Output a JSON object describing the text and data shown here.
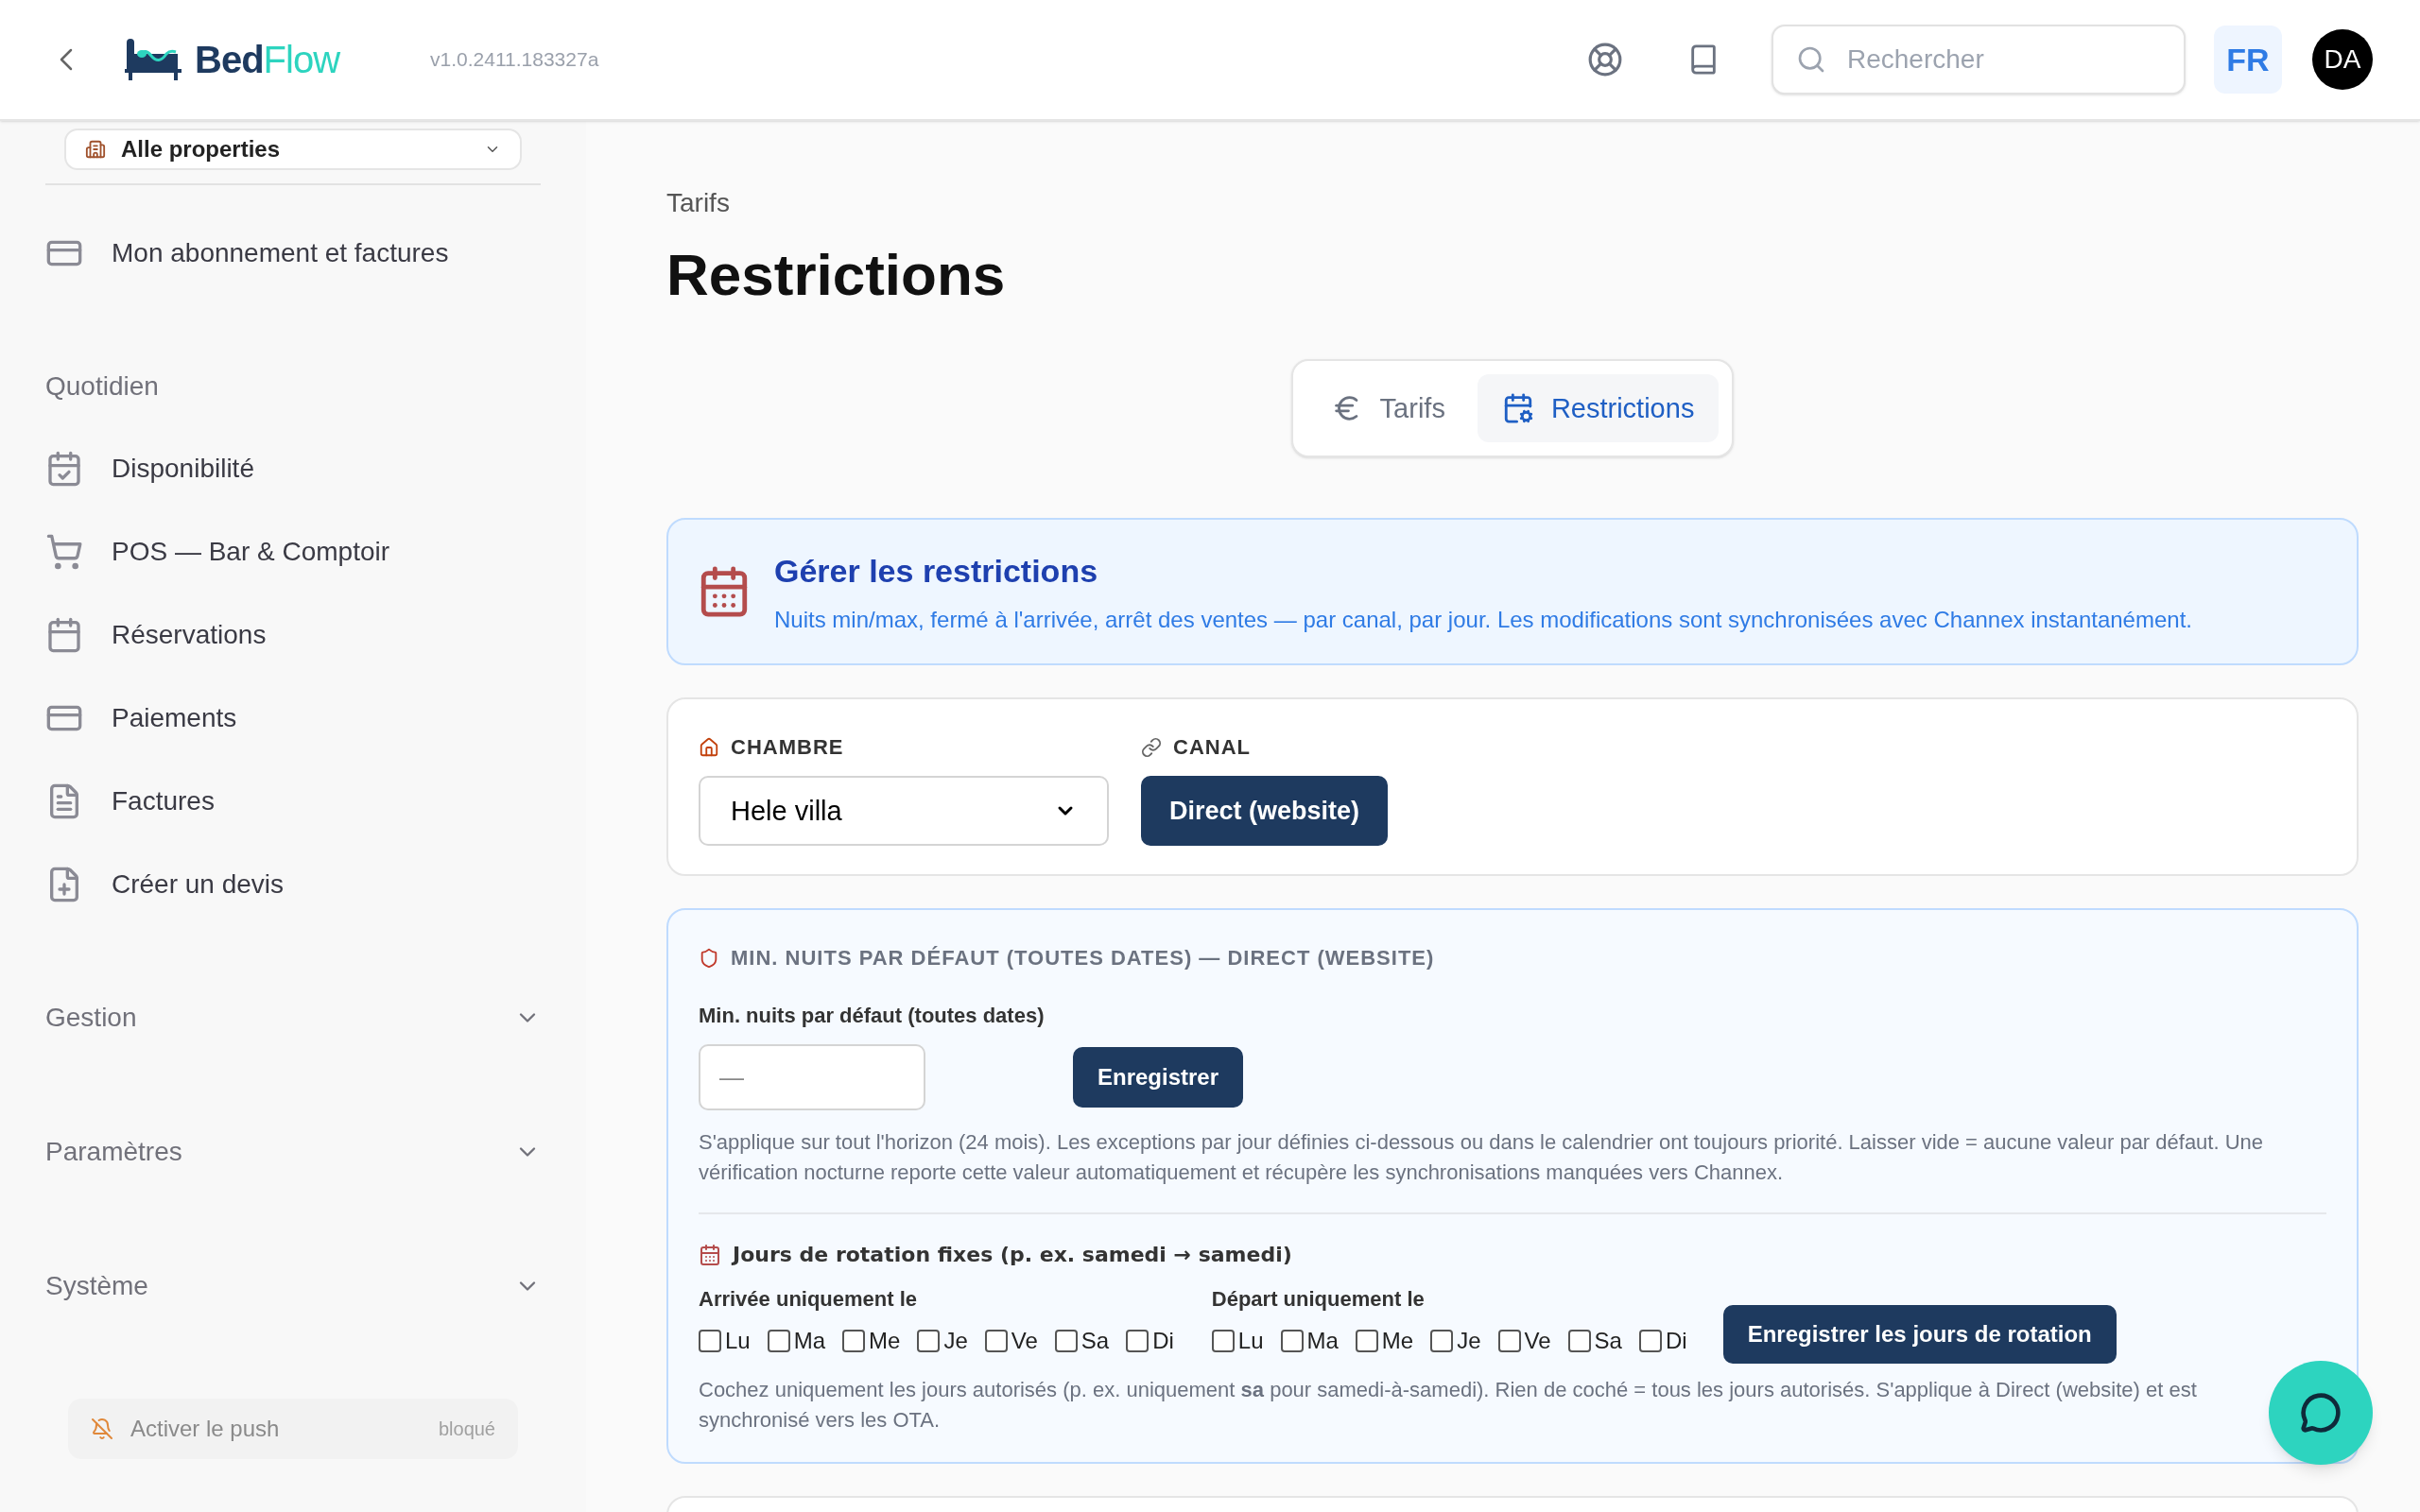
{
  "header": {
    "logo": [
      "Bed",
      "Flow"
    ],
    "version": "v1.0.2411.183327a",
    "search": {
      "placeholder": "Rechercher"
    },
    "language": "FR",
    "avatar": "DA"
  },
  "sidebar": {
    "property_select": "Alle properties",
    "top_items": [
      {
        "label": "Mon abonnement et factures",
        "kind": "card"
      }
    ],
    "section": "Quotidien",
    "items": [
      {
        "label": "Disponibilité",
        "kind": "calendar-check"
      },
      {
        "label": "POS — Bar & Comptoir",
        "kind": "cart"
      },
      {
        "label": "Réservations",
        "kind": "calendar"
      },
      {
        "label": "Paiements",
        "kind": "card"
      },
      {
        "label": "Factures",
        "kind": "file"
      },
      {
        "label": "Créer un devis",
        "kind": "file-plus"
      }
    ],
    "groups": [
      {
        "label": "Gestion",
        "expanded": false
      },
      {
        "label": "Paramètres",
        "expanded": false
      },
      {
        "label": "Système",
        "expanded": false
      }
    ],
    "push": {
      "label": "Activer le push",
      "status": "bloqué"
    }
  },
  "breadcrumb": "Tarifs",
  "title": "Restrictions",
  "tabs": [
    {
      "label": "Tarifs",
      "kind": "euro",
      "selected": false
    },
    {
      "label": "Restrictions",
      "kind": "calendar-cog",
      "selected": true
    }
  ],
  "banner": {
    "title": "Gérer les restrictions",
    "text": "Nuits min/max, fermé à l'arrivée, arrêt des ventes — par canal, par jour. Les modifications sont synchronisées avec Channex instantanément."
  },
  "filters": {
    "room_label": "CHAMBRE",
    "room_value": "Hele villa",
    "channel_label": "CANAL",
    "channels": [
      {
        "label": "Direct (website)",
        "selected": true
      }
    ]
  },
  "min_nights": {
    "heading": "MIN. NUITS PAR DÉFAUT (TOUTES DATES) — DIRECT (WEBSITE)",
    "field_label": "Min. nuits par défaut (toutes dates)",
    "placeholder": "—",
    "save": "Enregistrer",
    "help": "S'applique sur tout l'horizon (24 mois). Les exceptions par jour définies ci-dessous ou dans le calendrier ont toujours priorité. Laisser vide = aucune valeur par défaut. Une vérification nocturne reporte cette valeur automatiquement et récupère les synchronisations manquées vers Channex."
  },
  "rotation": {
    "heading": "Jours de rotation fixes (p. ex. samedi → samedi)",
    "groups": [
      {
        "label": "Arrivée uniquement le",
        "days": [
          {
            "label": "Lu",
            "checked": false
          },
          {
            "label": "Ma",
            "checked": false
          },
          {
            "label": "Me",
            "checked": false
          },
          {
            "label": "Je",
            "checked": false
          },
          {
            "label": "Ve",
            "checked": false
          },
          {
            "label": "Sa",
            "checked": false
          },
          {
            "label": "Di",
            "checked": false
          }
        ]
      },
      {
        "label": "Départ uniquement le",
        "days": [
          {
            "label": "Lu",
            "checked": false
          },
          {
            "label": "Ma",
            "checked": false
          },
          {
            "label": "Me",
            "checked": false
          },
          {
            "label": "Je",
            "checked": false
          },
          {
            "label": "Ve",
            "checked": false
          },
          {
            "label": "Sa",
            "checked": false
          },
          {
            "label": "Di",
            "checked": false
          }
        ]
      }
    ],
    "save": "Enregistrer les jours de rotation",
    "help": "Cochez uniquement les jours autorisés (p. ex. uniquement **sa** pour samedi-à-samedi). Rien de coché = tous les jours autorisés. S'applique à Direct (website) et est synchronisé vers les OTA."
  }
}
